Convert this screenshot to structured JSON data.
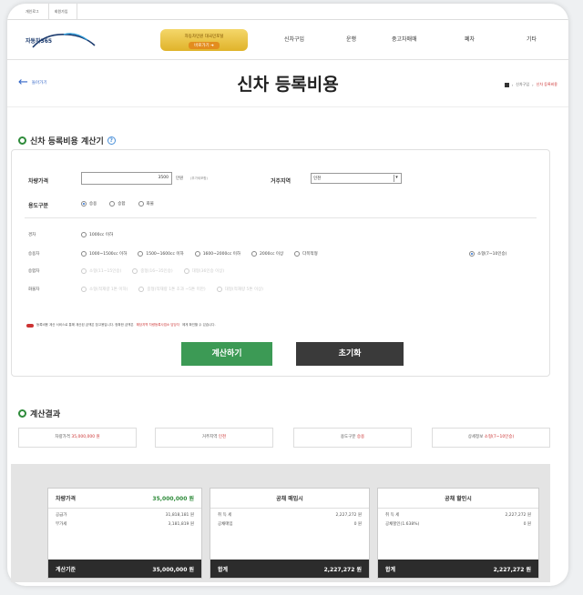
{
  "topbar": {
    "links": [
      "개인로그",
      "회원가입"
    ]
  },
  "header": {
    "logo_text": "자동차365",
    "banner_line1": "자동차민원 대국민포털",
    "banner_line2": "바로가기 ➜",
    "menu": [
      "신차구입",
      "운행",
      "중고차매매",
      "폐차",
      "기타"
    ]
  },
  "title_bar": {
    "back_label": "돌아가기",
    "page_title": "신차 등록비용",
    "breadcrumb": [
      "신차구입",
      "신차 등록비용"
    ]
  },
  "calculator": {
    "heading": "신차 등록비용 계산기",
    "help": "?",
    "price_label": "차량가격",
    "price_value": "3500",
    "price_unit": "만원",
    "price_note": "(부가세포함)",
    "region_label": "거주지역",
    "region_value": "인천",
    "usage_label": "용도구분",
    "usage_options": [
      "승용",
      "승합",
      "화물"
    ],
    "type_labels": [
      "경차",
      "승용차",
      "승합차",
      "화물차"
    ],
    "light_option": "1000cc 이하",
    "car_options": [
      "1000~1500cc 이하",
      "1500~1600cc 이하",
      "1600~2000cc 이하",
      "2000cc 이상",
      "다목적형",
      "소형(7~10인승)"
    ],
    "van_options": [
      "소형(11~15인승)",
      "중형(16~35인승)",
      "대형(36인승 이상)"
    ],
    "truck_options": [
      "소형(적재량 1톤 이하)",
      "중형(적재량 1톤 초과 ~5톤 미만)",
      "대형(적재량 5톤 이상)"
    ],
    "warning_prefix": "등록비용 계산 서비스로 통해 계산된 금액은 참고용입니다. 정확한 금액은",
    "warning_link": "해당지역 차량등록사업소 담당자",
    "warning_suffix": "에게 확인할 수 있습니다.",
    "calc_button": "계산하기",
    "reset_button": "초기화"
  },
  "result": {
    "heading": "계산결과",
    "cells": [
      {
        "label": "차량가격",
        "value": "35,000,000 원"
      },
      {
        "label": "거주지역",
        "value": "인천"
      },
      {
        "label": "용도구분",
        "value": "승용"
      },
      {
        "label": "상세정보",
        "value": "소형(7~10인승)"
      }
    ]
  },
  "summary": {
    "price_card": {
      "title": "차량가격",
      "title_value": "35,000,000 원",
      "rows": [
        {
          "label": "공급가",
          "value": "31,818,181 원"
        },
        {
          "label": "부가세",
          "value": "3,181,819 원"
        }
      ],
      "footer_label": "계산기준",
      "footer_value": "35,000,000 원"
    },
    "bond_buy_card": {
      "title": "공채 매입시",
      "rows": [
        {
          "label": "취 득 세",
          "value": "2,227,272 원"
        },
        {
          "label": "공채매입",
          "value": "0 원"
        }
      ],
      "footer_label": "합계",
      "footer_value": "2,227,272 원"
    },
    "bond_discount_card": {
      "title": "공채 할인시",
      "rows": [
        {
          "label": "취 득 세",
          "value": "2,227,272 원"
        },
        {
          "label": "공채할인(1.638%)",
          "value": "0 원"
        }
      ],
      "footer_label": "합계",
      "footer_value": "2,227,272 원"
    }
  }
}
